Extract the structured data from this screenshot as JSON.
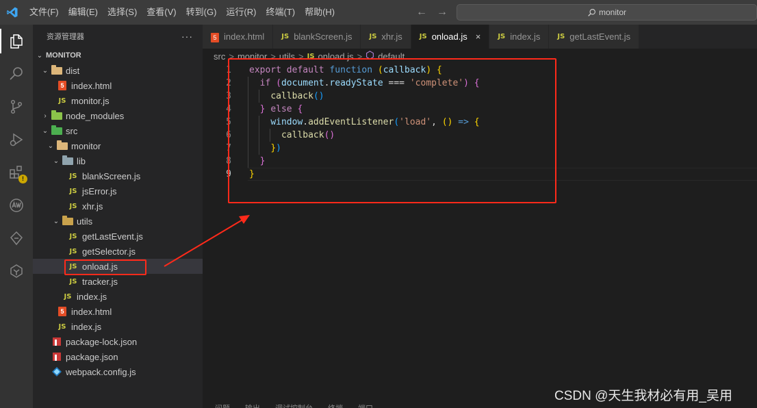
{
  "menu": [
    "文件(F)",
    "编辑(E)",
    "选择(S)",
    "查看(V)",
    "转到(G)",
    "运行(R)",
    "终端(T)",
    "帮助(H)"
  ],
  "search": {
    "text": "monitor"
  },
  "activity": [
    "explorer-icon",
    "search-icon",
    "source-control-icon",
    "run-debug-icon",
    "extensions-icon",
    "aw-icon",
    "git-graph-icon",
    "tabnine-icon"
  ],
  "activity_badge": "!",
  "sidebar": {
    "title": "资源管理器",
    "more": "···",
    "root": "MONITOR",
    "tree": [
      {
        "label": "dist",
        "type": "folder",
        "open": true
      },
      {
        "label": "index.html",
        "type": "html"
      },
      {
        "label": "monitor.js",
        "type": "js"
      },
      {
        "label": "node_modules",
        "type": "folder",
        "open": false
      },
      {
        "label": "src",
        "type": "folder",
        "open": true
      },
      {
        "label": "monitor",
        "type": "folder",
        "open": true
      },
      {
        "label": "lib",
        "type": "folder",
        "open": true
      },
      {
        "label": "blankScreen.js",
        "type": "js"
      },
      {
        "label": "jsError.js",
        "type": "js"
      },
      {
        "label": "xhr.js",
        "type": "js"
      },
      {
        "label": "utils",
        "type": "folder",
        "open": true
      },
      {
        "label": "getLastEvent.js",
        "type": "js"
      },
      {
        "label": "getSelector.js",
        "type": "js"
      },
      {
        "label": "onload.js",
        "type": "js",
        "selected": true
      },
      {
        "label": "tracker.js",
        "type": "js"
      },
      {
        "label": "index.js",
        "type": "js"
      },
      {
        "label": "index.html",
        "type": "html"
      },
      {
        "label": "index.js",
        "type": "js"
      },
      {
        "label": "package-lock.json",
        "type": "npm"
      },
      {
        "label": "package.json",
        "type": "npm"
      },
      {
        "label": "webpack.config.js",
        "type": "webpack"
      }
    ]
  },
  "tabs": [
    {
      "label": "index.html",
      "icon": "5",
      "type": "html"
    },
    {
      "label": "blankScreen.js",
      "icon": "JS",
      "type": "js"
    },
    {
      "label": "xhr.js",
      "icon": "JS",
      "type": "js"
    },
    {
      "label": "onload.js",
      "icon": "JS",
      "type": "js",
      "active": true,
      "close": "×"
    },
    {
      "label": "index.js",
      "icon": "JS",
      "type": "js"
    },
    {
      "label": "getLastEvent.js",
      "icon": "JS",
      "type": "js"
    }
  ],
  "breadcrumb": [
    "src",
    "monitor",
    "utils",
    "onload.js",
    "default"
  ],
  "breadcrumb_sep": ">",
  "breadcrumb_js": "JS",
  "code_lines": [
    [
      [
        "kw",
        "export"
      ],
      [
        "pu",
        " "
      ],
      [
        "kw",
        "default"
      ],
      [
        "pu",
        " "
      ],
      [
        "kwb",
        "function"
      ],
      [
        "pu",
        " "
      ],
      [
        "br1",
        "("
      ],
      [
        "vr",
        "callback"
      ],
      [
        "br1",
        ")"
      ],
      [
        "pu",
        " "
      ],
      [
        "br1",
        "{"
      ]
    ],
    [
      [
        "pu",
        "  "
      ],
      [
        "kw",
        "if"
      ],
      [
        "pu",
        " "
      ],
      [
        "br2",
        "("
      ],
      [
        "vr",
        "document"
      ],
      [
        "pu",
        "."
      ],
      [
        "vr",
        "readyState"
      ],
      [
        "pu",
        " === "
      ],
      [
        "st",
        "'complete'"
      ],
      [
        "br2",
        ")"
      ],
      [
        "pu",
        " "
      ],
      [
        "br2",
        "{"
      ]
    ],
    [
      [
        "pu",
        "    "
      ],
      [
        "fn",
        "callback"
      ],
      [
        "br3",
        "()"
      ]
    ],
    [
      [
        "pu",
        "  "
      ],
      [
        "br2",
        "}"
      ],
      [
        "pu",
        " "
      ],
      [
        "kw",
        "else"
      ],
      [
        "pu",
        " "
      ],
      [
        "br2",
        "{"
      ]
    ],
    [
      [
        "pu",
        "    "
      ],
      [
        "vr",
        "window"
      ],
      [
        "pu",
        "."
      ],
      [
        "fn",
        "addEventListener"
      ],
      [
        "br3",
        "("
      ],
      [
        "st",
        "'load'"
      ],
      [
        "pu",
        ", "
      ],
      [
        "br1",
        "()"
      ],
      [
        "pu",
        " "
      ],
      [
        "kwb",
        "=>"
      ],
      [
        "pu",
        " "
      ],
      [
        "br1",
        "{"
      ]
    ],
    [
      [
        "pu",
        "      "
      ],
      [
        "fn",
        "callback"
      ],
      [
        "br2",
        "()"
      ]
    ],
    [
      [
        "pu",
        "    "
      ],
      [
        "br1",
        "}"
      ],
      [
        "br3",
        ")"
      ]
    ],
    [
      [
        "pu",
        "  "
      ],
      [
        "br2",
        "}"
      ]
    ],
    [
      [
        "br1",
        "}"
      ]
    ]
  ],
  "line_numbers": [
    "1",
    "2",
    "3",
    "4",
    "5",
    "6",
    "7",
    "8",
    "9"
  ],
  "panel_tabs": [
    "问题",
    "输出",
    "调试控制台",
    "终端",
    "端口"
  ],
  "watermark": "CSDN @天生我材必有用_吴用"
}
